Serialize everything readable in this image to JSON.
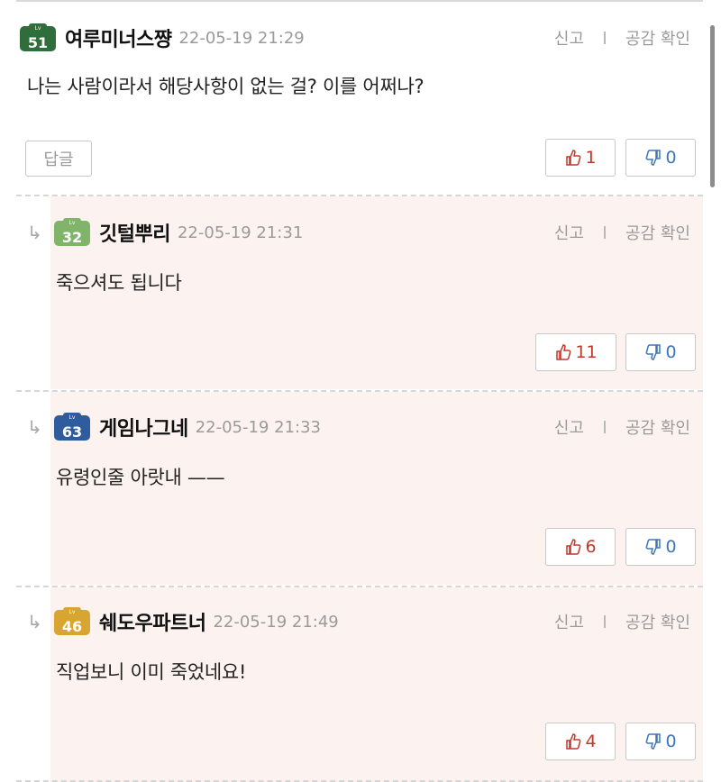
{
  "colors": {
    "reply_bg": "#fcf3f0",
    "up": "#c0392b",
    "down": "#3b78b5",
    "muted": "#9a9a9a"
  },
  "actions": {
    "report": "신고",
    "likes_check": "공감 확인"
  },
  "reply_button": "답글",
  "comments": [
    {
      "level": "51",
      "level_color": "#2f6e3b",
      "nickname": "여루미너스쨩",
      "date": "22-05-19 21:29",
      "text": "나는 사람이라서 해당사항이 없는 걸? 이를 어쩌나?",
      "up": "1",
      "down": "0",
      "is_reply": false
    },
    {
      "level": "32",
      "level_color": "#7fb46a",
      "nickname": "깃털뿌리",
      "date": "22-05-19 21:31",
      "text": "죽으셔도 됩니다",
      "up": "11",
      "down": "0",
      "is_reply": true
    },
    {
      "level": "63",
      "level_color": "#2f5c9c",
      "nickname": "게임나그네",
      "date": "22-05-19 21:33",
      "text": "유령인줄 아랏내 ——",
      "up": "6",
      "down": "0",
      "is_reply": true
    },
    {
      "level": "46",
      "level_color": "#d9a531",
      "nickname": "쉐도우파트너",
      "date": "22-05-19 21:49",
      "text": "직업보니 이미 죽었네요!",
      "up": "4",
      "down": "0",
      "is_reply": true
    }
  ]
}
